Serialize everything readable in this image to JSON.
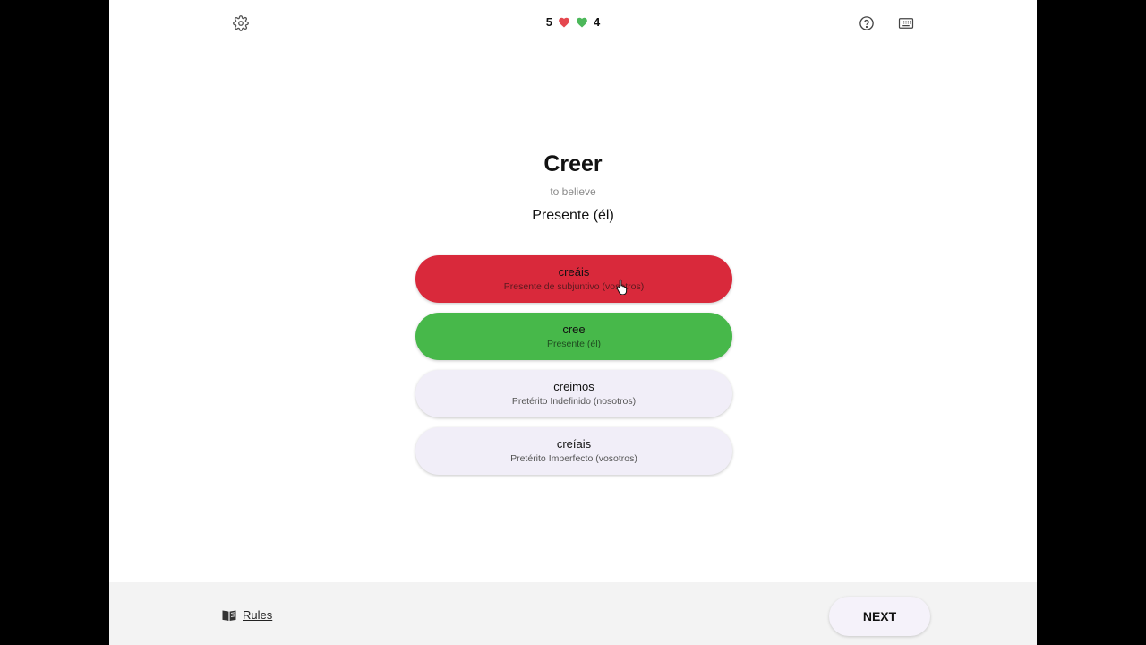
{
  "score": {
    "wrong_count": "5",
    "correct_count": "4"
  },
  "colors": {
    "wrong": "#d9293b",
    "correct": "#47b84a",
    "neutral_option": "#f1eef8",
    "heart_red": "#e5474f",
    "heart_green": "#4cb85a"
  },
  "icons": {
    "settings": "gear-icon",
    "help": "help-circle-icon",
    "keyboard": "keyboard-icon",
    "rules": "book-icon",
    "cursor": "hand-pointer-icon"
  },
  "prompt": {
    "verb": "Creer",
    "translation": "to believe",
    "tense": "Presente (él)"
  },
  "options": [
    {
      "form": "creáis",
      "description": "Presente de subjuntivo (vosotros)",
      "state": "wrong"
    },
    {
      "form": "cree",
      "description": "Presente (él)",
      "state": "correct"
    },
    {
      "form": "creimos",
      "description": "Pretérito Indefinido (nosotros)",
      "state": "neutral"
    },
    {
      "form": "creíais",
      "description": "Pretérito Imperfecto (vosotros)",
      "state": "neutral"
    }
  ],
  "footer": {
    "rules_label": "Rules",
    "next_label": "NEXT"
  }
}
